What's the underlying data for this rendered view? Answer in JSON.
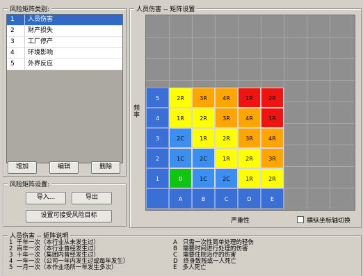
{
  "category_panel": {
    "title": "风险矩阵类别:",
    "items": [
      {
        "num": "1",
        "label": "人员伤害"
      },
      {
        "num": "2",
        "label": "财产损失"
      },
      {
        "num": "3",
        "label": "工厂停产"
      },
      {
        "num": "4",
        "label": "环境影响"
      },
      {
        "num": "5",
        "label": "外界反应"
      }
    ],
    "buttons": {
      "add": "增加",
      "edit": "编辑",
      "delete": "删除"
    }
  },
  "setup_panel": {
    "title": "风险矩阵设置:",
    "import": "导入...",
    "export": "导出",
    "set_target": "设置可接受风险目标"
  },
  "matrix_panel": {
    "title": "人员伤害 -- 矩阵设置",
    "y_axis_label": "频率",
    "x_axis_label": "严重性",
    "toggle_label": "横纵坐标轴切换",
    "row_labels": [
      "5",
      "4",
      "3",
      "2",
      "1"
    ],
    "col_labels": [
      "A",
      "B",
      "C",
      "D",
      "E"
    ],
    "rows": [
      [
        "2R",
        "3R",
        "4R",
        "1R",
        "2R"
      ],
      [
        "1R",
        "2R",
        "3R",
        "4R",
        "1R"
      ],
      [
        "2C",
        "1R",
        "2R",
        "3R",
        "4R"
      ],
      [
        "1C",
        "2C",
        "1R",
        "2R",
        "3R"
      ],
      [
        "0",
        "1C",
        "2C",
        "1R",
        "2R"
      ]
    ],
    "colors": {
      "red": "#ef1410",
      "orange": "#ffa500",
      "yellow": "#ffff00",
      "blue": "#3c8ff0",
      "green": "#11c411"
    },
    "row_colors": [
      [
        "yellow",
        "orange",
        "orange",
        "red",
        "red"
      ],
      [
        "yellow",
        "yellow",
        "orange",
        "orange",
        "red"
      ],
      [
        "blue",
        "yellow",
        "yellow",
        "orange",
        "orange"
      ],
      [
        "blue",
        "blue",
        "yellow",
        "yellow",
        "orange"
      ],
      [
        "green",
        "blue",
        "blue",
        "yellow",
        "yellow"
      ]
    ]
  },
  "description": {
    "title": "人员伤害 -- 矩阵说明",
    "frequency": [
      {
        "num": "1",
        "text": "千年一次（本行业从未发生过）"
      },
      {
        "num": "2",
        "text": "百年一次（本行业曾经发生过）"
      },
      {
        "num": "3",
        "text": "十年一次（集团内曾经发生过）"
      },
      {
        "num": "4",
        "text": "一年一次（公司一年内发生过或每年发生）"
      },
      {
        "num": "5",
        "text": "一月一次（本作业场所一年发生多次）"
      }
    ],
    "severity": [
      {
        "letter": "A",
        "text": "只需一次性简单处理的轻伤"
      },
      {
        "letter": "B",
        "text": "需要时间进行处理的伤害"
      },
      {
        "letter": "C",
        "text": "需要住院治疗的伤害"
      },
      {
        "letter": "D",
        "text": "终身致残或一人死亡"
      },
      {
        "letter": "E",
        "text": "多人死亡"
      }
    ]
  }
}
